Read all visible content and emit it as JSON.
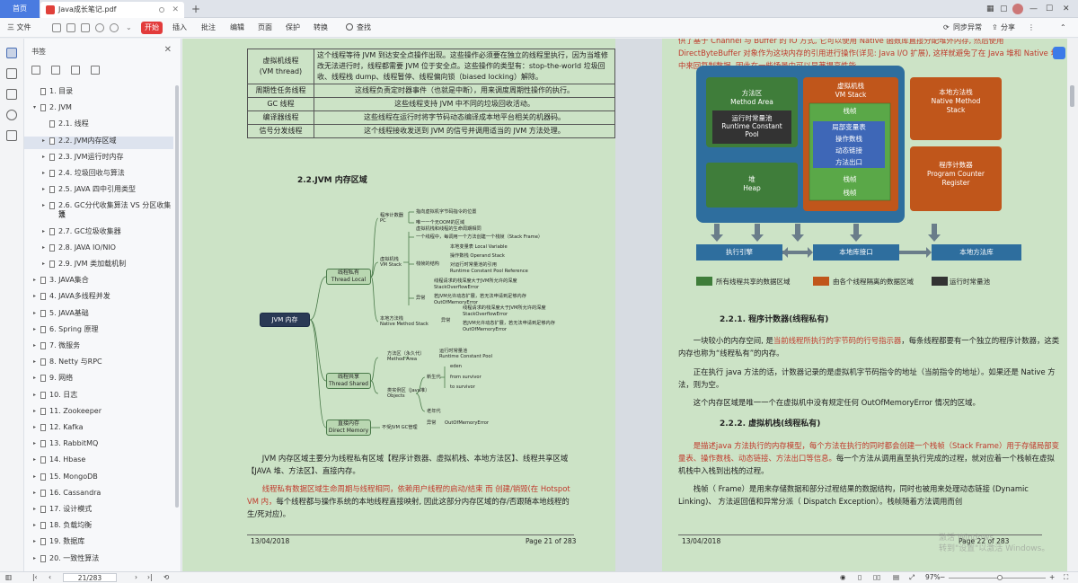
{
  "tabs": {
    "home": "首页",
    "doc": "Java成长笔记.pdf",
    "add": "+"
  },
  "window": {
    "minimize": "—",
    "maximize": "☐",
    "close": "✕"
  },
  "toolbar": {
    "file": "三 文件",
    "start": "开始",
    "insert": "插入",
    "annotate": "批注",
    "edit": "编辑",
    "page": "页面",
    "protect": "保护",
    "convert": "转换",
    "search": "查找",
    "sync": "同步异常",
    "share": "分享"
  },
  "bookmarks": {
    "title": "书签",
    "items": [
      {
        "label": "1. 目录",
        "level": 1,
        "arrow": ""
      },
      {
        "label": "2. JVM",
        "level": 1,
        "arrow": "▾"
      },
      {
        "label": "2.1. 线程",
        "level": 2,
        "arrow": ""
      },
      {
        "label": "2.2. JVM内存区域",
        "level": 2,
        "arrow": "▸"
      },
      {
        "label": "2.3. JVM运行时内存",
        "level": 2,
        "arrow": "▸"
      },
      {
        "label": "2.4. 垃圾回收与算法",
        "level": 2,
        "arrow": "▸"
      },
      {
        "label": "2.5. JAVA 四中引用类型",
        "level": 2,
        "arrow": "▸"
      },
      {
        "label": "2.6. GC分代收集算法  VS 分区收集算",
        "label2": "法",
        "level": 2,
        "arrow": "▸"
      },
      {
        "label": "2.7. GC垃圾收集器",
        "level": 2,
        "arrow": "▸"
      },
      {
        "label": "2.8.  JAVA IO/NIO",
        "level": 2,
        "arrow": "▸"
      },
      {
        "label": "2.9. JVM 类加载机制",
        "level": 2,
        "arrow": "▸"
      },
      {
        "label": "3. JAVA集合",
        "level": 1,
        "arrow": "▸"
      },
      {
        "label": "4. JAVA多线程并发",
        "level": 1,
        "arrow": "▸"
      },
      {
        "label": "5. JAVA基础",
        "level": 1,
        "arrow": "▸"
      },
      {
        "label": "6. Spring 原理",
        "level": 1,
        "arrow": "▸"
      },
      {
        "label": "7.  微服务",
        "level": 1,
        "arrow": "▸"
      },
      {
        "label": "8. Netty 与RPC",
        "level": 1,
        "arrow": "▸"
      },
      {
        "label": "9. 网络",
        "level": 1,
        "arrow": "▸"
      },
      {
        "label": "10. 日志",
        "level": 1,
        "arrow": "▸"
      },
      {
        "label": "11. Zookeeper",
        "level": 1,
        "arrow": "▸"
      },
      {
        "label": "12. Kafka",
        "level": 1,
        "arrow": "▸"
      },
      {
        "label": "13. RabbitMQ",
        "level": 1,
        "arrow": "▸"
      },
      {
        "label": "14. Hbase",
        "level": 1,
        "arrow": "▸"
      },
      {
        "label": "15. MongoDB",
        "level": 1,
        "arrow": "▸"
      },
      {
        "label": "16. Cassandra",
        "level": 1,
        "arrow": "▸"
      },
      {
        "label": "17. 设计模式",
        "level": 1,
        "arrow": "▸"
      },
      {
        "label": "18. 负载均衡",
        "level": 1,
        "arrow": "▸"
      },
      {
        "label": "19. 数据库",
        "level": 1,
        "arrow": "▸"
      },
      {
        "label": "20. 一致性算法",
        "level": 1,
        "arrow": "▸"
      }
    ]
  },
  "left_page": {
    "table": [
      {
        "name": "虚拟机线程\n(VM thread)",
        "desc": "这个线程等待 JVM 到达安全点操作出现。这些操作必须要在独立的线程里执行，因为当堆修改无法进行时，线程都需要 JVM 位于安全点。这些操作的类型有：stop-the-world 垃圾回收、线程栈 dump、线程暂停、线程偏向锁（biased locking）解除。"
      },
      {
        "name": "周期性任务线程",
        "desc": "这线程负责定时器事件（也就是中断），用来调度周期性操作的执行。"
      },
      {
        "name": "GC 线程",
        "desc": "这些线程支持 JVM 中不同的垃圾回收活动。"
      },
      {
        "name": "编译器线程",
        "desc": "这些线程在运行时将字节码动态编译成本地平台相关的机器码。"
      },
      {
        "name": "信号分发线程",
        "desc": "这个线程接收发送到 JVM 的信号并调用适当的 JVM 方法处理。"
      }
    ],
    "section": "2.2.JVM 内存区域",
    "mindmap": {
      "root": "JVM 内存",
      "thread_local": "线程私有\nThread Local",
      "thread_shared": "线程共享\nThread Shared",
      "direct": "直接内存\nDirect Memory",
      "pc": "程序计数器\nPC",
      "pc_notes": [
        "指向虚拟机字节码指令的位置",
        "唯一一个无OOM的区域"
      ],
      "vm_stack": "虚拟机栈\nVM Stack",
      "vm_stack_notes": [
        "虚拟机栈和线程的生命周期相同",
        "一个线程中，每调用一个方法创建一个栈帧（Stack Frame）"
      ],
      "frame": "栈帧的结构",
      "frame_notes": [
        "本地变量表 Local Variable",
        "操作数栈 Operand Stack",
        "对运行时常量池的引用",
        "Runtime Constant Pool Reference"
      ],
      "exception": "异常",
      "exception_notes": [
        "线程请求的栈深度大于JVM所允许的深度",
        "StackOverflowError",
        "若JVM允许动态扩展，若无法申请到足够内存",
        "OutOfMemoryError"
      ],
      "native": "本地方法栈\nNative Method Stack",
      "native_notes": [
        "异常",
        "线程请求的栈深度大于JVM所允许的深度",
        "StackOverflowError",
        "若JVM允许动态扩展，若无法申请到足够内存",
        "OutOfMemoryError"
      ],
      "method_area": "方法区（永久代）\nMethod Area",
      "method_area_note": "运行时常量池\nRuntime Constant Pool",
      "heap": "类实例区（Java堆）\nObjects",
      "young": "新生代",
      "young_notes": [
        "eden",
        "from survivor",
        "to survivor"
      ],
      "old": "老年代",
      "except2": "异常",
      "oom": "OutOfMemoryError",
      "direct_note": "不受JVM GC管理"
    },
    "para1": "JVM 内存区域主要分为线程私有区域【程序计数器、虚拟机栈、本地方法区】、线程共享区域【JAVA 堆、方法区】、直接内存。",
    "para2_red": "线程私有数据区域生命周期与线程相同，依赖用户线程的启动/结束 而 创建/销毁(在 Hotspot VM 内，",
    "para2_rest": "每个线程都与操作系统的本地线程直接映射, 因此这部分内存区域的存/否跟随本地线程的生/死对应)。",
    "footer_date": "13/04/2018",
    "footer_page": "Page 21 of 283"
  },
  "right_page": {
    "top_text": "供了基于 Channel 与 Buffer 的 IO 方式, 它可以使用 Native 函数库直接分配堆外内存, 然后使用 DirectByteBuffer 对象作为这块内存的引用进行操作(详见: Java I/O 扩展), 这样就避免了在 Java 堆和 Native 堆中来回复制数据, 因此在一些场景中可以显著提高性能。",
    "diagram": {
      "method_area": "方法区\nMethod Area",
      "rcp": "运行时常量池\nRuntime Constant\nPool",
      "heap": "堆\nHeap",
      "vm_stack": "虚拟机栈\nVM Stack",
      "frame": "栈帧",
      "frame_items": [
        "局部变量表",
        "操作数栈",
        "动态链接",
        "方法出口"
      ],
      "native": "本地方法栈\nNative Method\nStack",
      "pc": "程序计数器\nProgram Counter\nRegister",
      "engine": "执行引擎",
      "native_iface": "本地库接口",
      "native_lib": "本地方法库"
    },
    "legend": [
      "所有线程共享的数据区域",
      "由各个线程隔离的数据区域",
      "运行时常量池"
    ],
    "h221": "2.2.1. 程序计数器(线程私有)",
    "p1_a": "一块较小的内存空间, 是",
    "p1_red": "当前线程所执行的字节码的行号指示器",
    "p1_b": "，每条线程都要有一个独立的程序计数器，这类内存也称为“线程私有”的内存。",
    "p2": "正在执行 java 方法的话，计数器记录的是虚拟机字节码指令的地址（当前指令的地址）。如果还是 Native 方法，则为空。",
    "p3": "这个内存区域是唯一一个在虚拟机中没有规定任何 OutOfMemoryError 情况的区域。",
    "h222": "2.2.2. 虚拟机栈(线程私有)",
    "p4_red": "是描述java 方法执行的内存模型，每个方法在执行的同时都会创建一个栈帧（Stack Frame）用于存储局部变量表、操作数栈、动态链接、方法出口等信息。",
    "p4_b": "每一个方法从调用直至执行完成的过程，就对应着一个栈帧在虚拟机栈中入栈到出栈的过程。",
    "p5": "栈帧（ Frame）是用来存储数据和部分过程结果的数据结构，同时也被用来处理动态链接 (Dynamic Linking)、 方法返回值和异常分派（ Dispatch Exception）。栈帧随着方法调用而创",
    "footer_date": "13/04/2018",
    "footer_page": "Page 22 of 283"
  },
  "watermark": {
    "line1": "激活 Windows",
    "line2": "转到\"设置\"以激活 Windows。"
  },
  "statusbar": {
    "page_input": "21/283",
    "zoom": "97%",
    "zoom_minus": "−",
    "zoom_plus": "+"
  },
  "colors": {
    "accent": "#4a7be0",
    "page_bg": "#cce3c6",
    "shared": "#3f7d3a",
    "isolated": "#c0561b",
    "pool": "#333333",
    "arrow": "#2f6a99"
  }
}
